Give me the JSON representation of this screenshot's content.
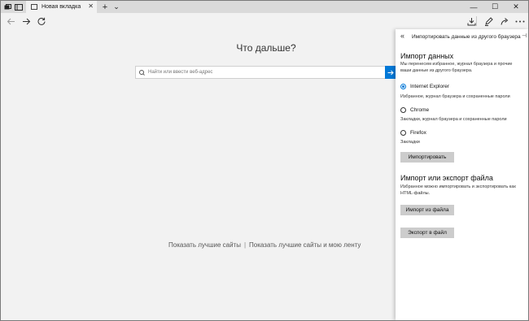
{
  "tabstrip": {
    "tab_title": "Новая вкладка",
    "new_tab_symbol": "+",
    "dropdown_symbol": "⌄",
    "close_symbol": "✕",
    "window_controls": [
      "—",
      "☐",
      "✕"
    ]
  },
  "toolbar": {
    "back_icon": "arrow-left",
    "forward_icon": "arrow-right",
    "refresh_icon": "refresh",
    "downloads_icon": "download",
    "pen_icon": "pen",
    "share_icon": "share",
    "more_icon": "ellipsis"
  },
  "newtab": {
    "heading": "Что дальше?",
    "search_placeholder": "Найти или ввести веб-адрес",
    "link_top_sites": "Показать лучшие сайты",
    "separator": "|",
    "link_top_sites_feed": "Показать лучшие сайты и мою ленту"
  },
  "panel": {
    "title": "Импортировать данные из другого браузера",
    "import_heading": "Импорт данных",
    "import_desc": "Мы перенесем избранное, журнал браузера и прочие ваши данные из другого браузера.",
    "browsers": [
      {
        "name": "Internet Explorer",
        "desc": "Избранное, журнал браузера и сохраненные пароли",
        "selected": true
      },
      {
        "name": "Chrome",
        "desc": "Закладки, журнал браузера и сохраненные пароли",
        "selected": false
      },
      {
        "name": "Firefox",
        "desc": "Закладки",
        "selected": false
      }
    ],
    "import_button": "Импортировать",
    "file_heading": "Импорт или экспорт файла",
    "file_desc": "Избранное можно импортировать и экспортировать как HTML-файлы.",
    "import_file_button": "Импорт из файла",
    "export_file_button": "Экспорт в файл"
  },
  "colors": {
    "accent": "#0078d7",
    "tabstrip_bg": "#dadada",
    "page_bg": "#f2f2f2",
    "button_bg": "#cccccc"
  }
}
